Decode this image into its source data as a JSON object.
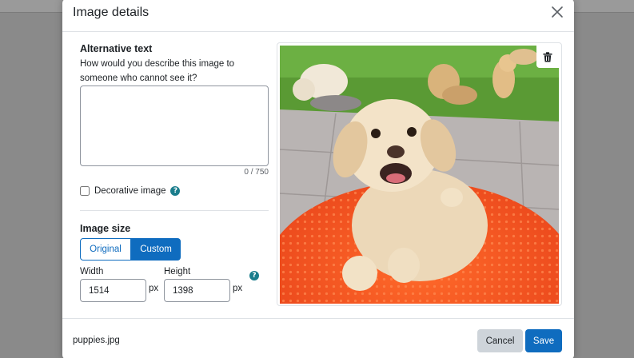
{
  "dialog": {
    "title": "Image details"
  },
  "alt_text": {
    "label": "Alternative text",
    "help": "How would you describe this image to someone who cannot see it?",
    "value": "",
    "char_count": "0 / 750"
  },
  "decorative": {
    "label": "Decorative image",
    "checked": false,
    "help_glyph": "?"
  },
  "image_size": {
    "label": "Image size",
    "options": [
      "Original",
      "Custom"
    ],
    "selected": "Custom",
    "width_label": "Width",
    "width_value": "1514",
    "height_label": "Height",
    "height_value": "1398",
    "unit": "px",
    "help_glyph": "?"
  },
  "footer": {
    "file_name": "puppies.jpg",
    "cancel_label": "Cancel",
    "save_label": "Save"
  },
  "colors": {
    "primary": "#0f6cbf",
    "help": "#1a7d8c",
    "secondary_button": "#ced4da"
  },
  "icons": {
    "close": "close-icon",
    "delete": "trash-icon"
  }
}
